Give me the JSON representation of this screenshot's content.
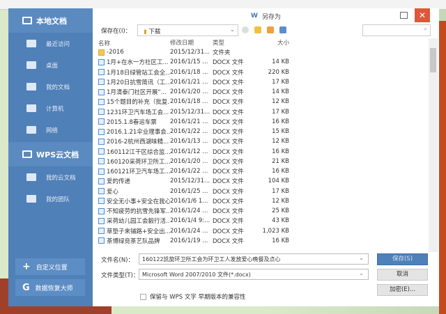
{
  "dialog": {
    "title": "另存为",
    "save_in_label": "保存在(I)：",
    "save_in_value": "下载"
  },
  "sidebar": {
    "local_header": "本地文档",
    "local_items": [
      {
        "label": "最近访问"
      },
      {
        "label": "桌面"
      },
      {
        "label": "我的文档"
      },
      {
        "label": "计算机"
      },
      {
        "label": "网络"
      }
    ],
    "cloud_header": "WPS云文档",
    "cloud_items": [
      {
        "label": "我的云文档"
      },
      {
        "label": "我的团队"
      }
    ],
    "custom_location": "自定义位置",
    "data_recovery": "数据恢复大师"
  },
  "columns": {
    "name": "名称",
    "date": "修改日期",
    "type": "类型",
    "size": "大小"
  },
  "files": [
    {
      "name": "-2016",
      "date": "2015/12/31...",
      "type": "文件夹",
      "size": "",
      "folder": true
    },
    {
      "name": "1月+在水一方社区工...",
      "date": "2016/1/15 ...",
      "type": "DOCX 文件",
      "size": "14 KB"
    },
    {
      "name": "1月18日绿管站工会全...",
      "date": "2016/1/18 ...",
      "type": "DOCX 文件",
      "size": "220 KB"
    },
    {
      "name": "1月20日抗雪简讯（工...",
      "date": "2016/1/21 ...",
      "type": "DOCX 文件",
      "size": "17 KB"
    },
    {
      "name": "1月清泰门社区开展“...",
      "date": "2016/1/20 ...",
      "type": "DOCX 文件",
      "size": "14 KB"
    },
    {
      "name": "15个题目的补充（批复...",
      "date": "2016/1/18 ...",
      "type": "DOCX 文件",
      "size": "12 KB"
    },
    {
      "name": "1231环卫汽车场工会...",
      "date": "2015/12/31...",
      "type": "DOCX 文件",
      "size": "17 KB"
    },
    {
      "name": "2015.1.8春运车票",
      "date": "2016/1/21 ...",
      "type": "DOCX 文件",
      "size": "16 KB"
    },
    {
      "name": "2016.1.21伞业理事会...",
      "date": "2016/1/22 ...",
      "type": "DOCX 文件",
      "size": "15 KB"
    },
    {
      "name": "2016-2杭州西湖味精...",
      "date": "2016/1/13 ...",
      "type": "DOCX 文件",
      "size": "12 KB"
    },
    {
      "name": "160112江干区综合监...",
      "date": "2016/1/12 ...",
      "type": "DOCX 文件",
      "size": "16 KB"
    },
    {
      "name": "160120采荷环卫所工...",
      "date": "2016/1/20 ...",
      "type": "DOCX 文件",
      "size": "21 KB"
    },
    {
      "name": "160121环卫汽车场工...",
      "date": "2016/1/22 ...",
      "type": "DOCX 文件",
      "size": "16 KB"
    },
    {
      "name": "爱的传递",
      "date": "2015/12/31...",
      "type": "DOCX 文件",
      "size": "104 KB"
    },
    {
      "name": "爱心",
      "date": "2016/1/25 ...",
      "type": "DOCX 文件",
      "size": "17 KB"
    },
    {
      "name": "安全无小事+安全在我心",
      "date": "2016/1/6 1...",
      "type": "DOCX 文件",
      "size": "12 KB"
    },
    {
      "name": "不知疲劳的抗雪先锋军...",
      "date": "2016/1/24 ...",
      "type": "DOCX 文件",
      "size": "25 KB"
    },
    {
      "name": "采荷幼儿园工会毅行活...",
      "date": "2016/1/4 9:...",
      "type": "DOCX 文件",
      "size": "43 KB"
    },
    {
      "name": "草垫子来铺路+安全出...",
      "date": "2016/1/24 ...",
      "type": "DOCX 文件",
      "size": "1,023 KB"
    },
    {
      "name": "茶博绿竞茶艺队品牌",
      "date": "2016/1/19 ...",
      "type": "DOCX 文件",
      "size": "16 KB"
    }
  ],
  "bottom": {
    "filename_label": "文件名(N)：",
    "filename_value": "160122凯旋环卫所工会为环卫工人发放爱心晚餐及点心",
    "filetype_label": "文件类型(T)：",
    "filetype_value": "Microsoft Word 2007/2010 文件(*.docx)",
    "compat_label": "保留与 WPS 文字 早期版本的兼容性",
    "save": "保存(S)",
    "cancel": "取消",
    "encrypt": "加密(E)..."
  },
  "colors": {
    "sidebar": "#4f80b8",
    "close": "#e0563a"
  }
}
